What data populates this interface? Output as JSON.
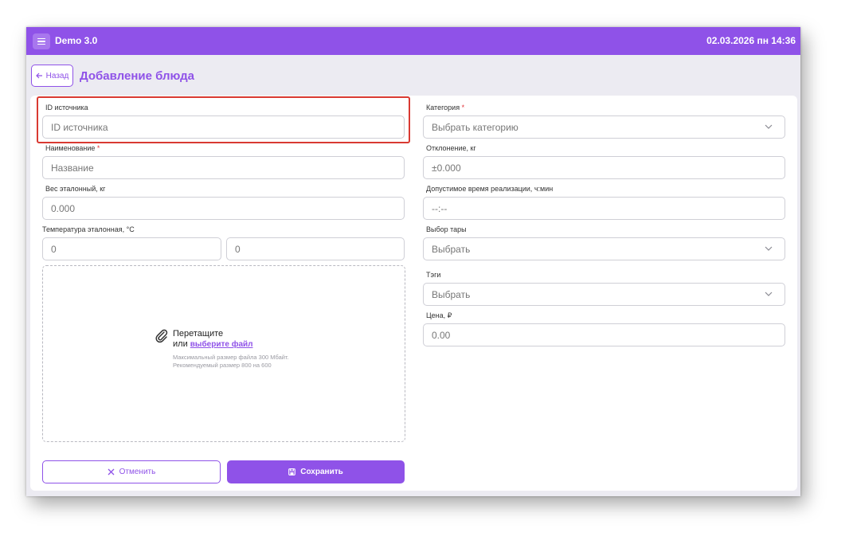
{
  "app": {
    "title": "Demo 3.0",
    "datetime": "02.03.2026 пн 14:36"
  },
  "header": {
    "back_label": "Назад",
    "page_title": "Добавление блюда"
  },
  "form": {
    "source_id": {
      "label": "ID источника",
      "placeholder": "ID источника"
    },
    "name": {
      "label": "Наименование",
      "required_mark": "*",
      "placeholder": "Название"
    },
    "weight": {
      "label": "Вес эталонный, кг",
      "value": "0.000"
    },
    "temperature": {
      "label": "Температура эталонная, °C",
      "min": "0",
      "max": "0"
    },
    "category": {
      "label": "Категория",
      "required_mark": "*",
      "value": "Выбрать категорию"
    },
    "deviation": {
      "label": "Отклонение, кг",
      "value": "±0.000"
    },
    "sale_time": {
      "label": "Допустимое время реализации, ч:мин",
      "value": "--:--"
    },
    "container": {
      "label": "Выбор тары",
      "value": "Выбрать"
    },
    "tags": {
      "label": "Тэги",
      "value": "Выбрать"
    },
    "price": {
      "label": "Цена, ₽",
      "value": "0.00"
    }
  },
  "upload": {
    "title": "Перетащите",
    "or_text": "или",
    "link_text": "выберите файл",
    "hint": "Максимальный размер файла 300 Мбайт. Рекомендуемый размер 800 на 600"
  },
  "actions": {
    "cancel_label": "Отменить",
    "save_label": "Сохранить"
  },
  "colors": {
    "accent": "#8f52e8",
    "highlight": "#d93a32",
    "background": "#ecebf2"
  },
  "icons": [
    "menu-icon",
    "arrow-left-icon",
    "chevron-down-icon",
    "paperclip-icon",
    "close-icon",
    "save-icon"
  ]
}
